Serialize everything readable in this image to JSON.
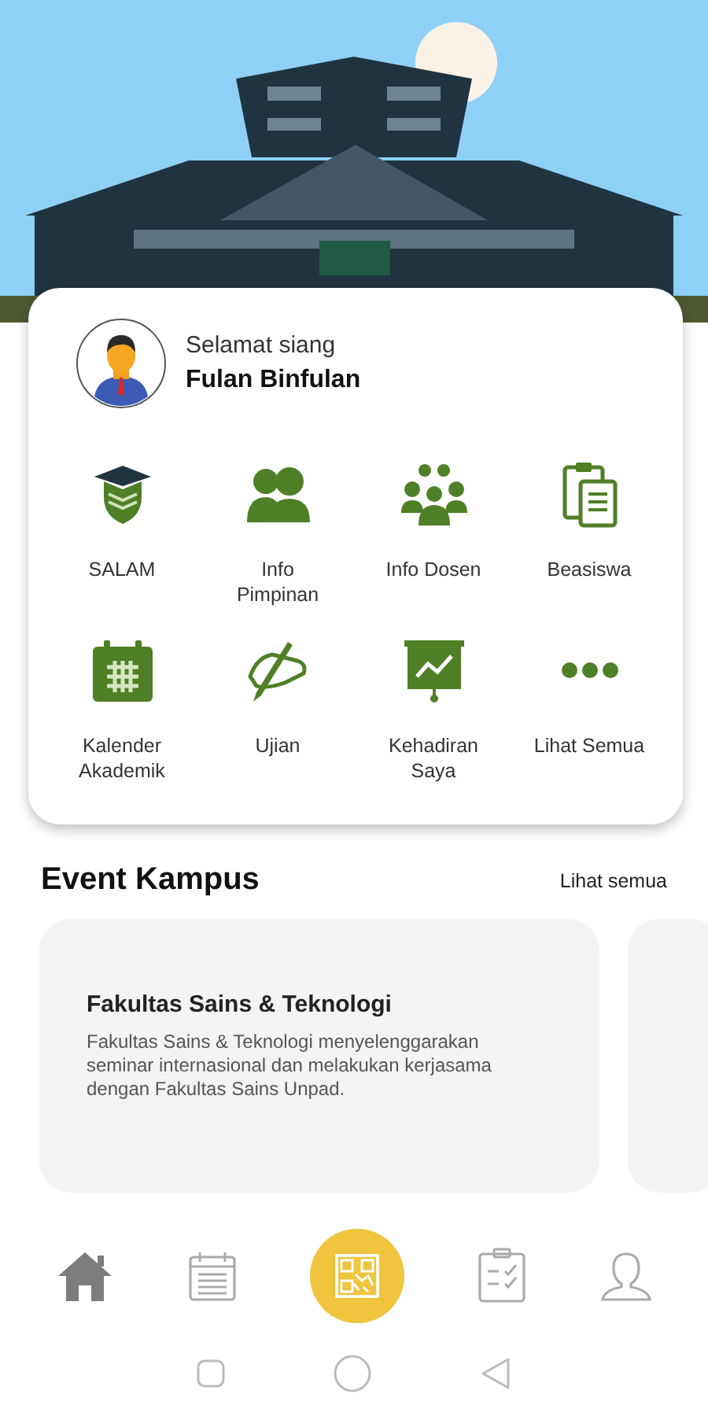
{
  "profile": {
    "greeting": "Selamat siang",
    "name": "Fulan Binfulan"
  },
  "menu": [
    {
      "kind": "salam",
      "label": "SALAM"
    },
    {
      "kind": "leaders",
      "label": "Info Pimpinan"
    },
    {
      "kind": "group",
      "label": "Info Dosen"
    },
    {
      "kind": "documents",
      "label": "Beasiswa"
    },
    {
      "kind": "calendar",
      "label": "Kalender Akademik"
    },
    {
      "kind": "writing",
      "label": "Ujian"
    },
    {
      "kind": "presentation",
      "label": "Kehadiran Saya"
    },
    {
      "kind": "more",
      "label": "Lihat Semua"
    }
  ],
  "events": {
    "title": "Event Kampus",
    "see_all": "Lihat semua",
    "cards": [
      {
        "title": "Fakultas Sains & Teknologi",
        "description": "Fakultas Sains & Teknologi menyelenggarakan seminar internasional dan melakukan kerjasama dengan Fakultas Sains Unpad."
      }
    ]
  },
  "bottom_nav": [
    {
      "kind": "home",
      "selected": true
    },
    {
      "kind": "calendar",
      "selected": false
    },
    {
      "kind": "scan",
      "selected": false
    },
    {
      "kind": "checklist",
      "selected": false
    },
    {
      "kind": "profile",
      "selected": false
    }
  ]
}
